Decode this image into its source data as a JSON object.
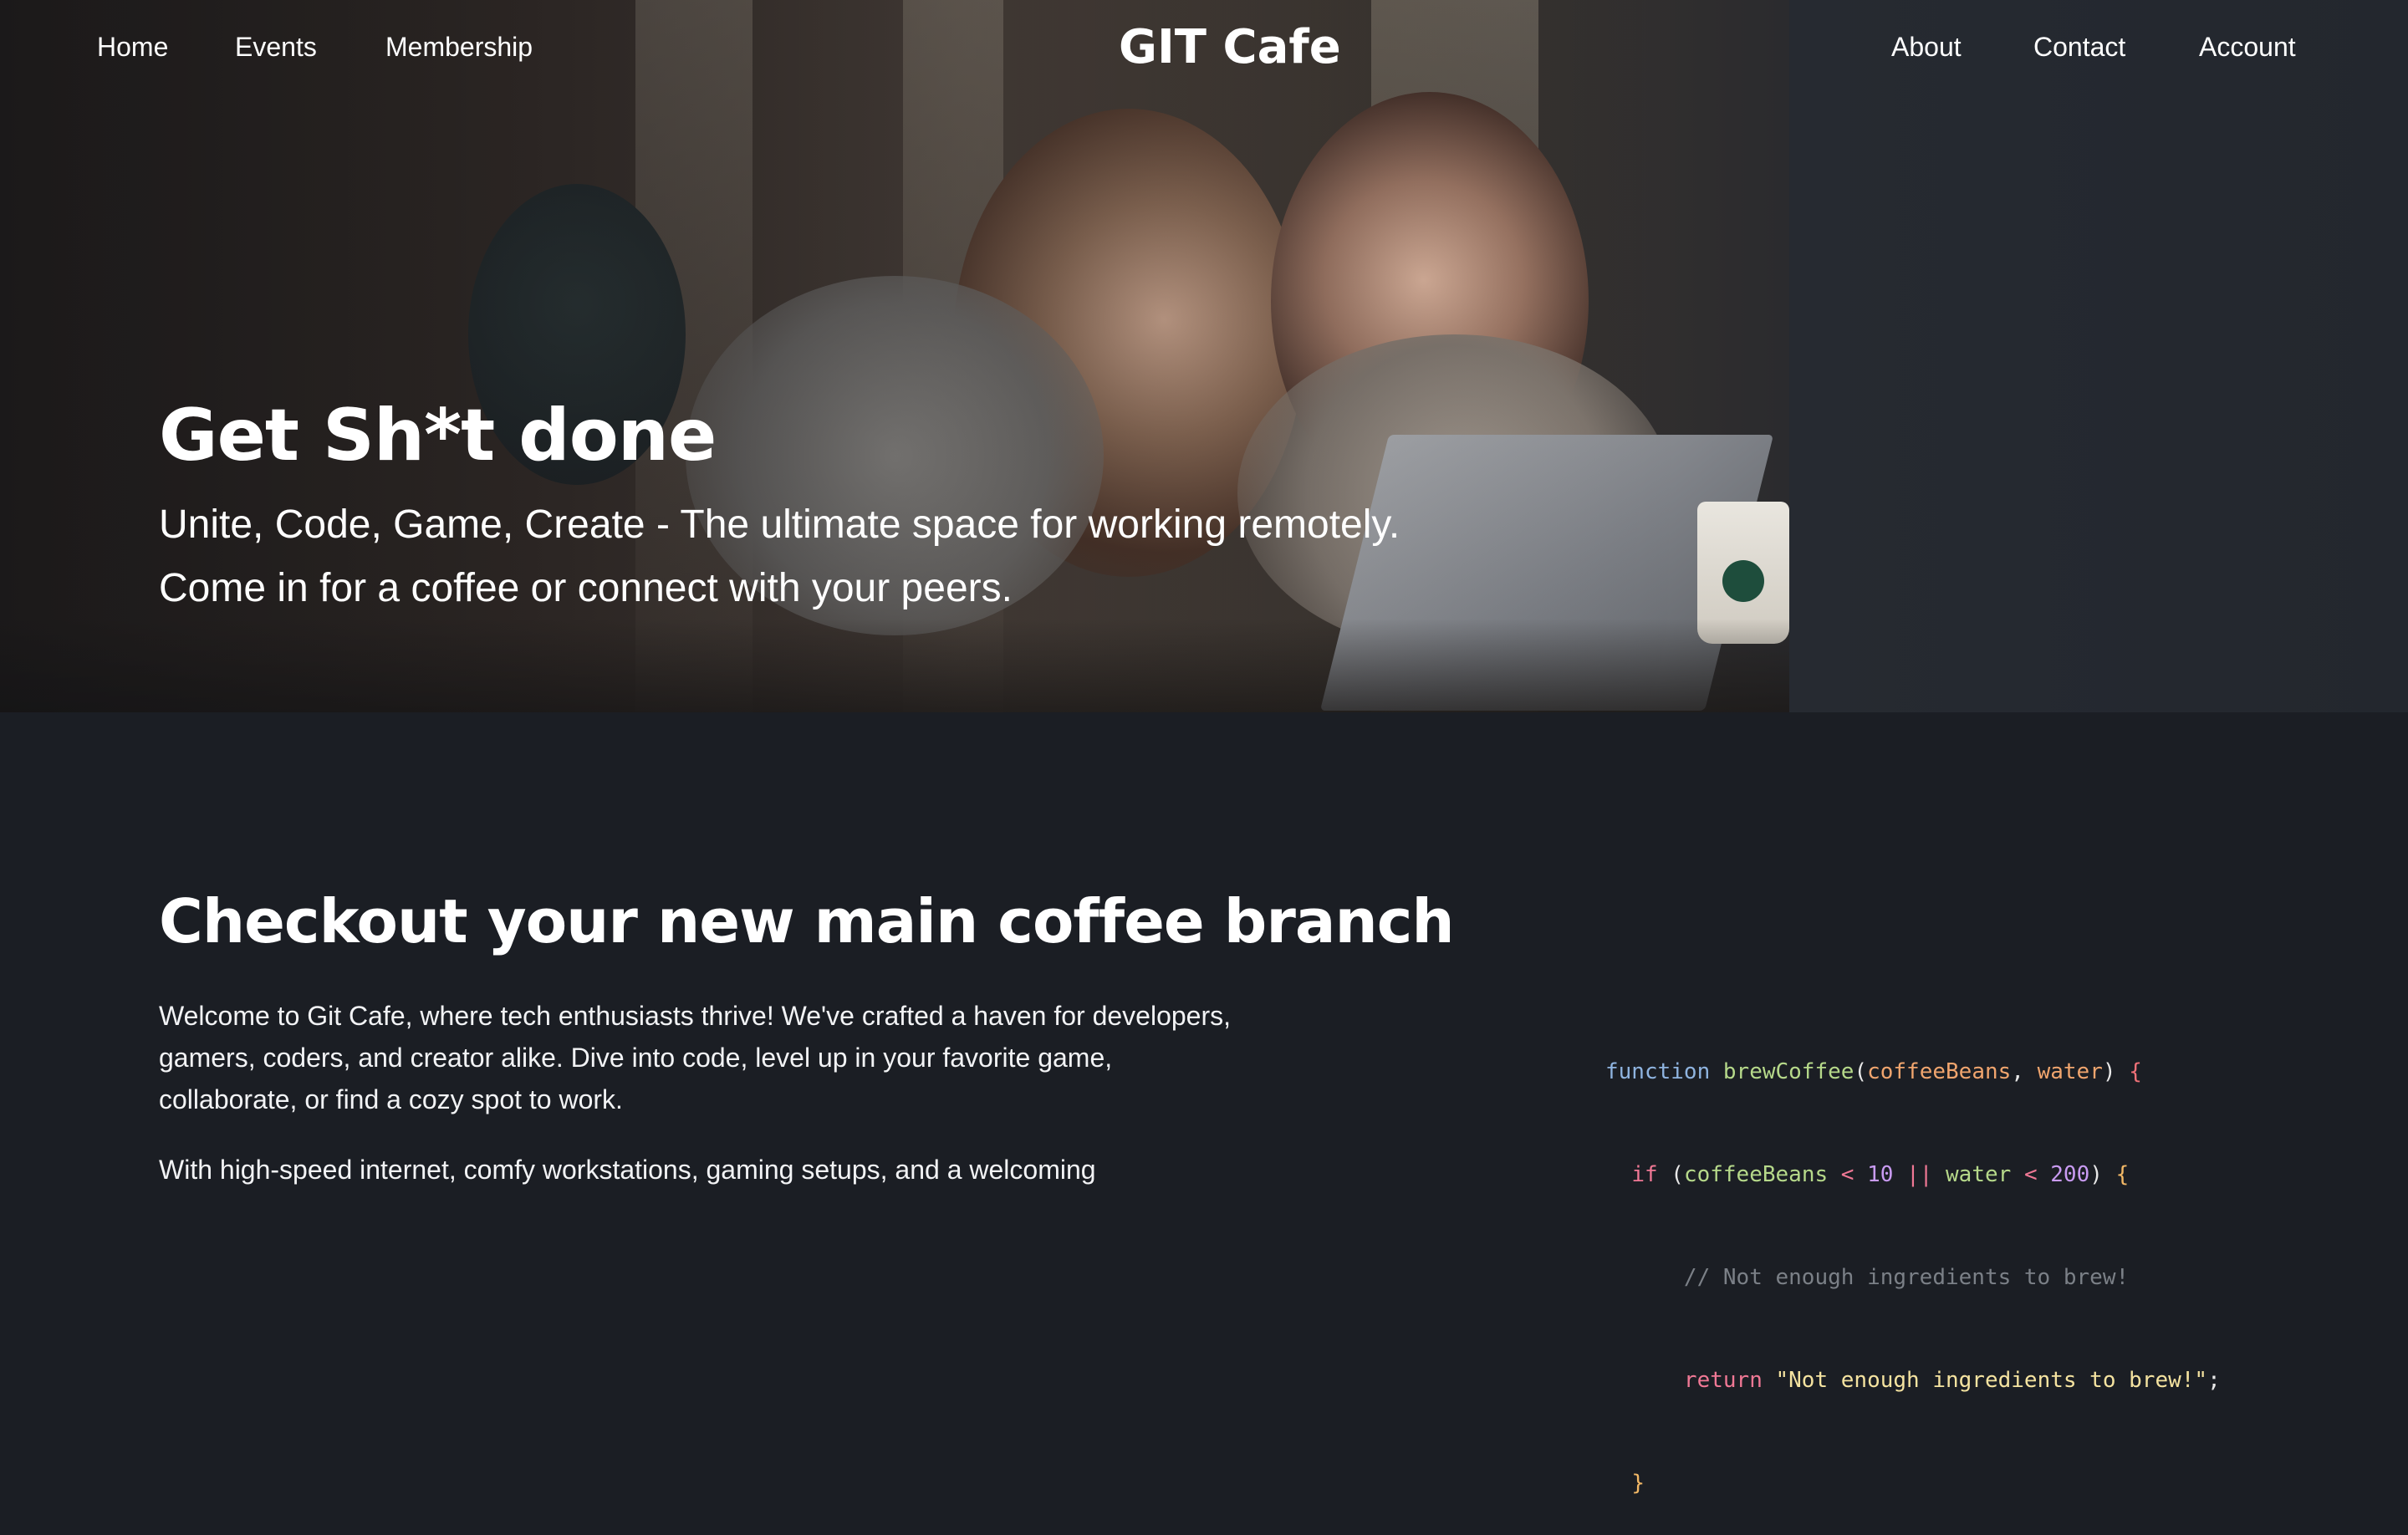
{
  "nav": {
    "left": [
      "Home",
      "Events",
      "Membership"
    ],
    "brand": "GIT Cafe",
    "right": [
      "About",
      "Contact",
      "Account"
    ]
  },
  "hero": {
    "title": "Get Sh*t done",
    "subtitle_lines": [
      "Unite, Code, Game, Create - The ultimate space for working remotely.",
      "Come in for a coffee or connect with your peers."
    ]
  },
  "section": {
    "title": "Checkout your new main coffee branch",
    "paragraph1_lines": [
      "Welcome to Git Cafe, where tech enthusiasts thrive! We've crafted a haven for developers,",
      "gamers, coders, and creator alike. Dive into code, level up in your favorite game,",
      "collaborate, or find a cozy spot to work."
    ],
    "paragraph2_lines": [
      "With high-speed internet, comfy workstations, gaming setups, and a welcoming"
    ]
  },
  "code": {
    "line1": {
      "kw": "function",
      "fn": "brewCoffee",
      "p1": "coffeeBeans",
      "p2": "water"
    },
    "line2": {
      "kw": "if",
      "p1": "coffeeBeans",
      "op1": "<",
      "n1": "10",
      "or": "||",
      "p2": "water",
      "op2": "<",
      "n2": "200"
    },
    "line3": {
      "comment": "// Not enough ingredients to brew!"
    },
    "line4": {
      "kw": "return",
      "str": "\"Not enough ingredients to brew!\""
    },
    "line5": {
      "brace": "}"
    }
  },
  "colors": {
    "background": "#1b1e24",
    "text": "#ffffff",
    "code_keyword": "#8fb4e0",
    "code_function": "#b6d98a",
    "code_param": "#f0a56e",
    "code_string": "#f5e3a0",
    "code_comment": "#7b8087"
  }
}
